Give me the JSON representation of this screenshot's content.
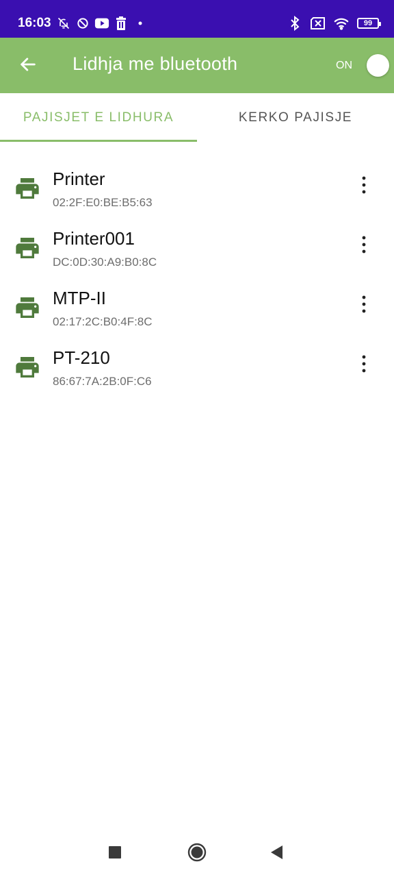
{
  "status_bar": {
    "time": "16:03",
    "left_icons": [
      "notifications-off-icon",
      "data-saver-icon",
      "youtube-icon",
      "trash-icon",
      "dot-icon"
    ],
    "right_icons": [
      "bluetooth-icon",
      "sim-x-icon",
      "wifi-icon"
    ],
    "battery": "99"
  },
  "app_bar": {
    "title": "Lidhja me bluetooth",
    "toggle_label": "ON",
    "background_color": "#89bd69"
  },
  "tabs": [
    {
      "label": "PAJISJET E LIDHURA",
      "active": true
    },
    {
      "label": "KERKO PAJISJE",
      "active": false
    }
  ],
  "devices": [
    {
      "name": "Printer",
      "address": "02:2F:E0:BE:B5:63",
      "icon": "printer-icon"
    },
    {
      "name": "Printer001",
      "address": "DC:0D:30:A9:B0:8C",
      "icon": "printer-icon"
    },
    {
      "name": "MTP-II",
      "address": "02:17:2C:B0:4F:8C",
      "icon": "printer-icon"
    },
    {
      "name": "PT-210",
      "address": "86:67:7A:2B:0F:C6",
      "icon": "printer-icon"
    }
  ],
  "colors": {
    "status_bar": "#3a0fb0",
    "accent": "#89bd69",
    "printer_icon": "#4f7a3c"
  },
  "nav_bar": {
    "buttons": [
      "recents-square-icon",
      "home-circle-icon",
      "back-triangle-icon"
    ]
  }
}
